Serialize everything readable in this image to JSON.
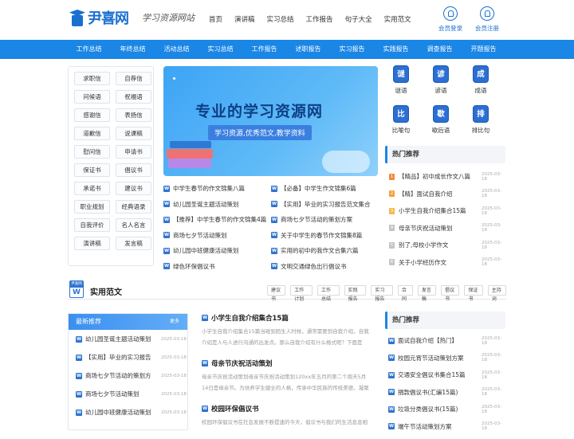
{
  "site": {
    "logo_text": "尹喜网",
    "slogan": "学习资源网站"
  },
  "topnav": [
    "首页",
    "演讲稿",
    "实习总结",
    "工作报告",
    "句子大全",
    "实用范文"
  ],
  "user_actions": {
    "login": "会员登录",
    "register": "会员注册"
  },
  "bluenav": [
    "工作总结",
    "年终总结",
    "活动总结",
    "实习总结",
    "工作报告",
    "述职报告",
    "实习报告",
    "实践报告",
    "调查报告",
    "开题报告"
  ],
  "categories": [
    "求职信",
    "自荐信",
    "问候语",
    "祝福语",
    "感谢信",
    "表扬信",
    "道歉信",
    "说课稿",
    "慰问信",
    "申请书",
    "保证书",
    "倡议书",
    "承诺书",
    "建议书",
    "职业规划",
    "经典语录",
    "自我评价",
    "名人名言",
    "演讲稿",
    "发言稿"
  ],
  "banner": {
    "title": "专业的学习资源网",
    "subtitle": "学习资源,优秀范文,教学资料"
  },
  "articles": [
    [
      "中学生春节的作文锦集八篇",
      "【必备】中学生作文锦集6篇"
    ],
    [
      "幼儿园圣诞主题活动策划",
      "【实用】毕业的实习报告范文集合"
    ],
    [
      "【推荐】中学生春节的作文锦集4篇",
      "商场七夕节活动的策划方案"
    ],
    [
      "商场七夕节活动策划",
      "关于中学生的春节作文锦集8篇"
    ],
    [
      "幼儿园中班健康活动策划",
      "实用的初中的我作文合集六篇"
    ],
    [
      "绿色环保倡议书",
      "文明交通绿色出行倡议书"
    ]
  ],
  "icons": [
    {
      "glyph": "谜",
      "label": "谜语",
      "icon": "riddle-icon"
    },
    {
      "glyph": "谚",
      "label": "谚语",
      "icon": "proverb-icon"
    },
    {
      "glyph": "成",
      "label": "成语",
      "icon": "idiom-icon"
    },
    {
      "glyph": "比",
      "label": "比喻句",
      "icon": "metaphor-icon"
    },
    {
      "glyph": "歇",
      "label": "歇后语",
      "icon": "xiehouyu-icon"
    },
    {
      "glyph": "排",
      "label": "排比句",
      "icon": "parallelism-icon"
    }
  ],
  "hot": {
    "title": "热门推荐",
    "items": [
      {
        "rank": "1",
        "text": "【精品】初中成长作文八篇",
        "date": "2025-03-18",
        "color": "#f08a3c"
      },
      {
        "rank": "2",
        "text": "【精】面试自我介绍",
        "date": "2025-03-18",
        "color": "#f2a33a"
      },
      {
        "rank": "3",
        "text": "小学生自我介绍集合15篇",
        "date": "2025-03-18",
        "color": "#f5b947"
      },
      {
        "rank": "4",
        "text": "母亲节庆祝活动策划",
        "date": "2025-03-18",
        "color": "#c4c4c4"
      },
      {
        "rank": "5",
        "text": "别了,母校小学作文",
        "date": "2025-03-18",
        "color": "#c4c4c4"
      },
      {
        "rank": "6",
        "text": "关于小学经历作文",
        "date": "2025-03-18",
        "color": "#c4c4c4"
      }
    ]
  },
  "section": {
    "mark_top": "尹喜网",
    "mark_letter": "W",
    "title": "实用范文",
    "tags": [
      "建议书",
      "工作计划",
      "工作总结",
      "实践报告",
      "实习报告",
      "合同",
      "发言稿",
      "倡议书",
      "保证书",
      "主持词"
    ]
  },
  "newest": {
    "title": "最新推荐",
    "more": "更多",
    "items": [
      {
        "text": "幼儿园圣诞主题活动策划",
        "date": "2025-03-18"
      },
      {
        "text": "【实用】毕业的实习报告",
        "date": "2025-03-18"
      },
      {
        "text": "商场七夕节活动的策划方",
        "date": "2025-03-18"
      },
      {
        "text": "商场七夕节活动策划",
        "date": "2025-03-18"
      },
      {
        "text": "幼儿园中班健康活动策划",
        "date": "2025-03-18"
      }
    ]
  },
  "features": [
    {
      "title": "小学生自我介绍集合15篇",
      "text": "小学生自我介绍集合15篇当碰到陌生人时候，通常需要到自我介绍，自我介绍是人与人进行沟通的出发点。那么自我介绍有什么格式呢？下面是"
    },
    {
      "title": "母亲节庆祝活动策划",
      "text": "母亲节庆祝活动策划母亲节庆祝活动策划120xx年五月的第二个周天5月14日是母亲节。为培养学生健全的人格，传承中华民族的传统美德，凝聚和"
    },
    {
      "title": "校园环保倡议书",
      "text": "校园环保倡议书在社会发展不断提速的今天，倡议书与我们的生活息息相"
    }
  ],
  "hot2": {
    "title": "热门推荐",
    "items": [
      {
        "text": "面试自我介绍【热门】",
        "date": "2025-03-18"
      },
      {
        "text": "校园元宵节活动策划方案",
        "date": "2025-03-18"
      },
      {
        "text": "交通安全倡议书集合15篇",
        "date": "2025-03-18"
      },
      {
        "text": "捐款倡议书(汇编15篇)",
        "date": "2025-03-18"
      },
      {
        "text": "垃圾分类倡议书(15篇)",
        "date": "2025-03-18"
      },
      {
        "text": "端午节活动策划方案",
        "date": "2025-03-18"
      }
    ]
  },
  "colors": {
    "brand": "#1a6fd0",
    "nav": "#1a86e6",
    "doc_icon": "#2f74d0"
  }
}
